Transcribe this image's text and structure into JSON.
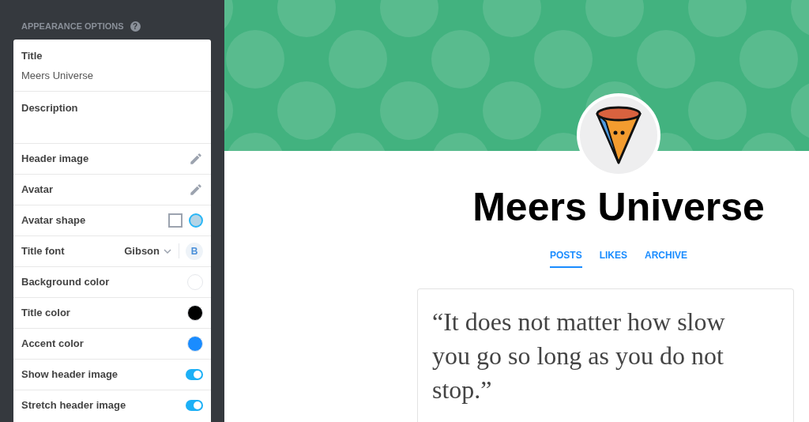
{
  "sidebar": {
    "heading": "APPEARANCE OPTIONS",
    "help_icon": "?",
    "fields": [
      {
        "label": "Title",
        "value": "Meers Universe"
      },
      {
        "label": "Description"
      }
    ],
    "rows": [
      {
        "kind": "edit",
        "label": "Header image"
      },
      {
        "kind": "edit",
        "label": "Avatar"
      },
      {
        "kind": "shape",
        "label": "Avatar shape",
        "options": [
          {
            "kind": "square",
            "selected": false
          },
          {
            "kind": "circle",
            "selected": true
          }
        ]
      },
      {
        "kind": "font",
        "label": "Title font",
        "value": "Gibson",
        "bold_label": "B",
        "bold": true
      },
      {
        "kind": "color",
        "label": "Background color",
        "color": "#ffffff"
      },
      {
        "kind": "color",
        "label": "Title color",
        "color": "#000000"
      },
      {
        "kind": "color",
        "label": "Accent color",
        "color": "#1a8cff"
      },
      {
        "kind": "toggle",
        "label": "Show header image",
        "on": true
      },
      {
        "kind": "toggle",
        "label": "Stretch header image",
        "on": true
      }
    ]
  },
  "blog": {
    "title": "Meers Universe",
    "tabs": [
      {
        "label": "POSTS",
        "selected": true
      },
      {
        "label": "LIKES",
        "selected": false
      },
      {
        "label": "ARCHIVE",
        "selected": false
      }
    ],
    "post": {
      "quote": "“It does not matter how slow you go so long as you do not stop.”"
    }
  }
}
